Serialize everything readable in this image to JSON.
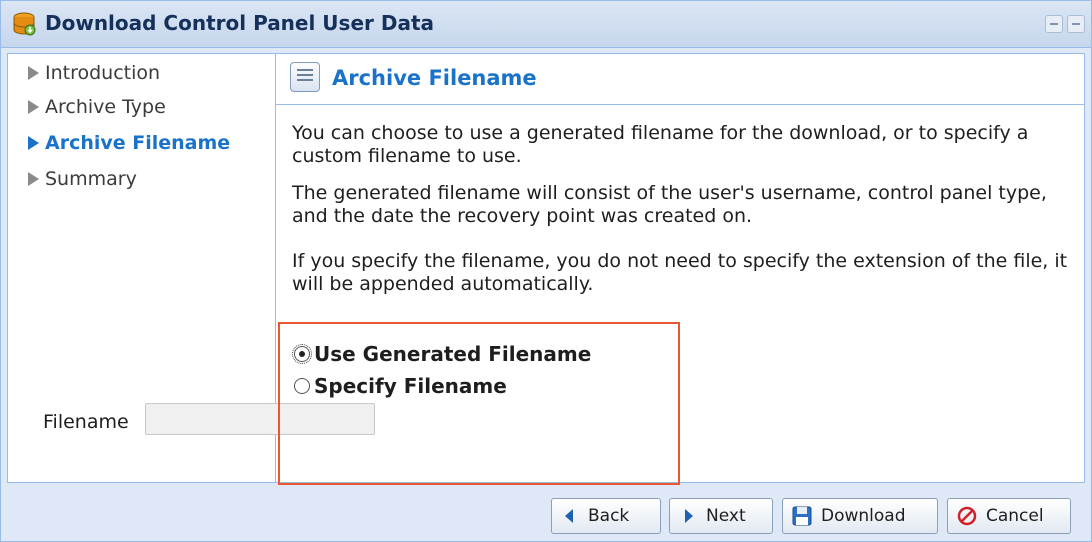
{
  "window": {
    "title": "Download Control Panel User Data"
  },
  "nav": {
    "items": [
      {
        "label": "Introduction",
        "active": false
      },
      {
        "label": "Archive Type",
        "active": false
      },
      {
        "label": "Archive Filename",
        "active": true
      },
      {
        "label": "Summary",
        "active": false
      }
    ]
  },
  "section": {
    "title": "Archive Filename",
    "paragraphs": [
      "You can choose to use a generated filename for the download, or to specify a custom filename to use.",
      "The generated filename will consist of the user's username, control panel type, and the date the recovery point was created on.",
      "If you specify the filename, you do not need to specify the extension of the file, it will be appended automatically."
    ]
  },
  "options": {
    "generated": {
      "label": "Use Generated Filename",
      "selected": true
    },
    "specify": {
      "label": "Specify Filename",
      "selected": false
    },
    "filename_label": "Filename",
    "filename_value": ""
  },
  "buttons": {
    "back": "Back",
    "next": "Next",
    "download": "Download",
    "cancel": "Cancel"
  },
  "colors": {
    "accent": "#1a73c9",
    "highlight": "#e8572f",
    "cancel_icon": "#d0202a"
  }
}
